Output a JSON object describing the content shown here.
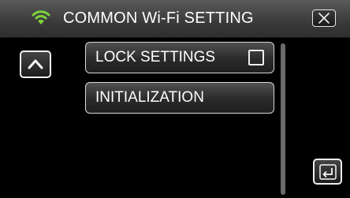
{
  "header": {
    "icon": "wifi-icon",
    "wifi_color": "#7cd23c",
    "title": "COMMON Wi-Fi SETTING",
    "close_icon": "close-icon"
  },
  "menu": {
    "items": [
      {
        "label": "LOCK SETTINGS",
        "has_checkbox": true,
        "checked": false
      },
      {
        "label": "INITIALIZATION",
        "has_checkbox": false
      }
    ]
  },
  "controls": {
    "up_icon": "chevron-up-icon",
    "back_icon": "back-return-icon"
  }
}
